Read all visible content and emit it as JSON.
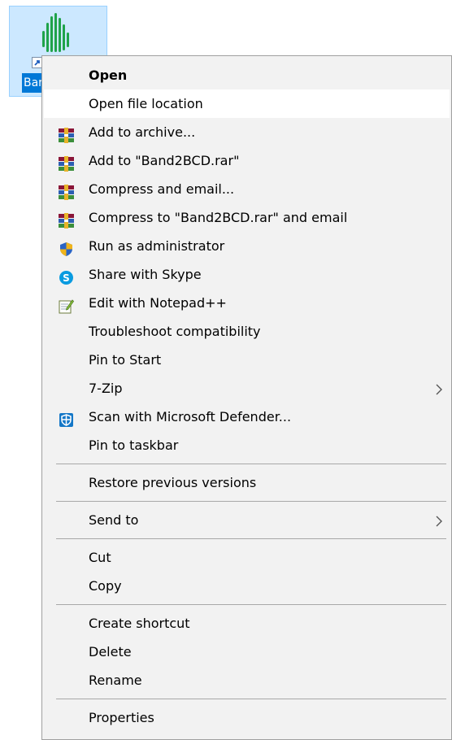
{
  "desktop_icon": {
    "label": "Bar"
  },
  "menu": {
    "groups": [
      [
        {
          "label": "Open",
          "bold": true
        },
        {
          "label": "Open file location",
          "highlighted": true
        },
        {
          "label": "Add to archive...",
          "icon": "winrar-icon"
        },
        {
          "label": "Add to \"Band2BCD.rar\"",
          "icon": "winrar-icon"
        },
        {
          "label": "Compress and email...",
          "icon": "winrar-icon"
        },
        {
          "label": "Compress to \"Band2BCD.rar\" and email",
          "icon": "winrar-icon"
        },
        {
          "label": "Run as administrator",
          "icon": "uac-shield-icon"
        },
        {
          "label": "Share with Skype",
          "icon": "skype-icon"
        },
        {
          "label": "Edit with Notepad++",
          "icon": "notepadpp-icon"
        },
        {
          "label": "Troubleshoot compatibility"
        },
        {
          "label": "Pin to Start"
        },
        {
          "label": "7-Zip",
          "submenu": true
        },
        {
          "label": "Scan with Microsoft Defender...",
          "icon": "defender-icon"
        },
        {
          "label": "Pin to taskbar"
        }
      ],
      [
        {
          "label": "Restore previous versions"
        }
      ],
      [
        {
          "label": "Send to",
          "submenu": true
        }
      ],
      [
        {
          "label": "Cut"
        },
        {
          "label": "Copy"
        }
      ],
      [
        {
          "label": "Create shortcut"
        },
        {
          "label": "Delete"
        },
        {
          "label": "Rename"
        }
      ],
      [
        {
          "label": "Properties"
        }
      ]
    ]
  },
  "colors": {
    "menu_background": "#f2f2f2",
    "highlight": "#ffffff",
    "selection": "#cce8ff",
    "label_selection": "#0078d7",
    "app_icon_green": "#1fa34a"
  }
}
